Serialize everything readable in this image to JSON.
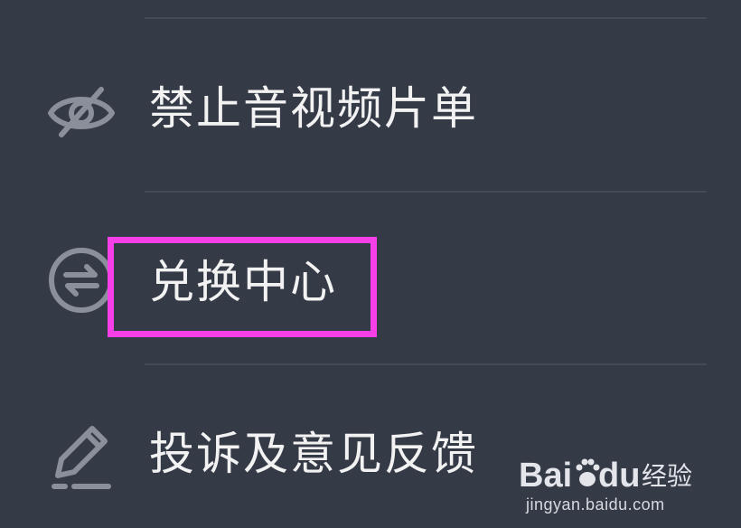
{
  "menu": {
    "items": [
      {
        "label": "禁止音视频片单",
        "icon": "eye-off-icon"
      },
      {
        "label": "兑换中心",
        "icon": "exchange-icon",
        "highlighted": true
      },
      {
        "label": "投诉及意见反馈",
        "icon": "pencil-icon"
      }
    ]
  },
  "colors": {
    "background": "#353a47",
    "divider": "#444a58",
    "icon": "#8a8f9a",
    "text": "#f2f2f2",
    "highlight": "#f63fe9"
  },
  "watermark": {
    "brand_latin": "Bai",
    "brand_latin_2": "du",
    "brand_cn": "经验",
    "url": "jingyan.baidu.com"
  }
}
